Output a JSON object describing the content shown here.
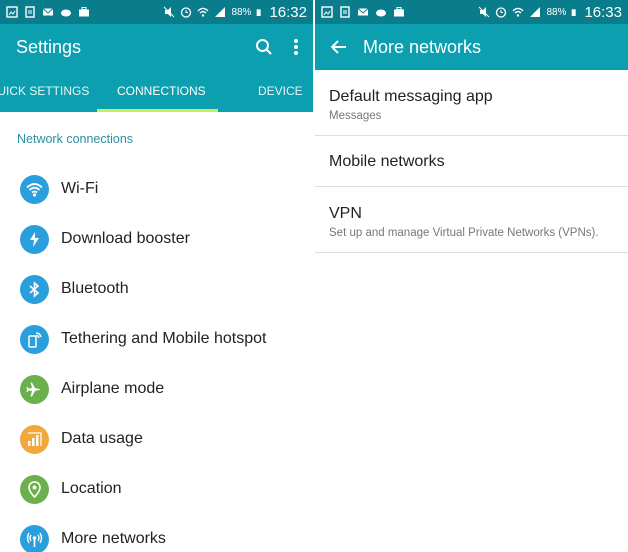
{
  "status_left": {
    "battery": "88%",
    "time": "16:32"
  },
  "status_right": {
    "battery": "88%",
    "time": "16:33"
  },
  "settings": {
    "title": "Settings",
    "tabs": [
      "QUICK SETTINGS",
      "CONNECTIONS",
      "DEVICE"
    ],
    "active_tab": "CONNECTIONS",
    "section_header": "Network connections",
    "items": [
      {
        "label": "Wi-Fi",
        "icon": "wifi-icon",
        "color": "#2a9fde"
      },
      {
        "label": "Download booster",
        "icon": "download-booster-icon",
        "color": "#2a9fde"
      },
      {
        "label": "Bluetooth",
        "icon": "bluetooth-icon",
        "color": "#2a9fde"
      },
      {
        "label": "Tethering and Mobile hotspot",
        "icon": "hotspot-icon",
        "color": "#2a9fde"
      },
      {
        "label": "Airplane mode",
        "icon": "airplane-icon",
        "color": "#6ab04c"
      },
      {
        "label": "Data usage",
        "icon": "data-usage-icon",
        "color": "#f0a73b"
      },
      {
        "label": "Location",
        "icon": "location-icon",
        "color": "#6ab04c"
      },
      {
        "label": "More networks",
        "icon": "more-networks-icon",
        "color": "#2a9fde"
      }
    ]
  },
  "more_networks": {
    "title": "More networks",
    "items": [
      {
        "label": "Default messaging app",
        "sub": "Messages"
      },
      {
        "label": "Mobile networks",
        "sub": ""
      },
      {
        "label": "VPN",
        "sub": "Set up and manage Virtual Private Networks (VPNs)."
      }
    ]
  },
  "colors": {
    "appbar": "#0c9fb0",
    "statusbar": "#0a7d8c",
    "accent": "#2c8ea0",
    "tab_indicator": "#c6f05a"
  }
}
